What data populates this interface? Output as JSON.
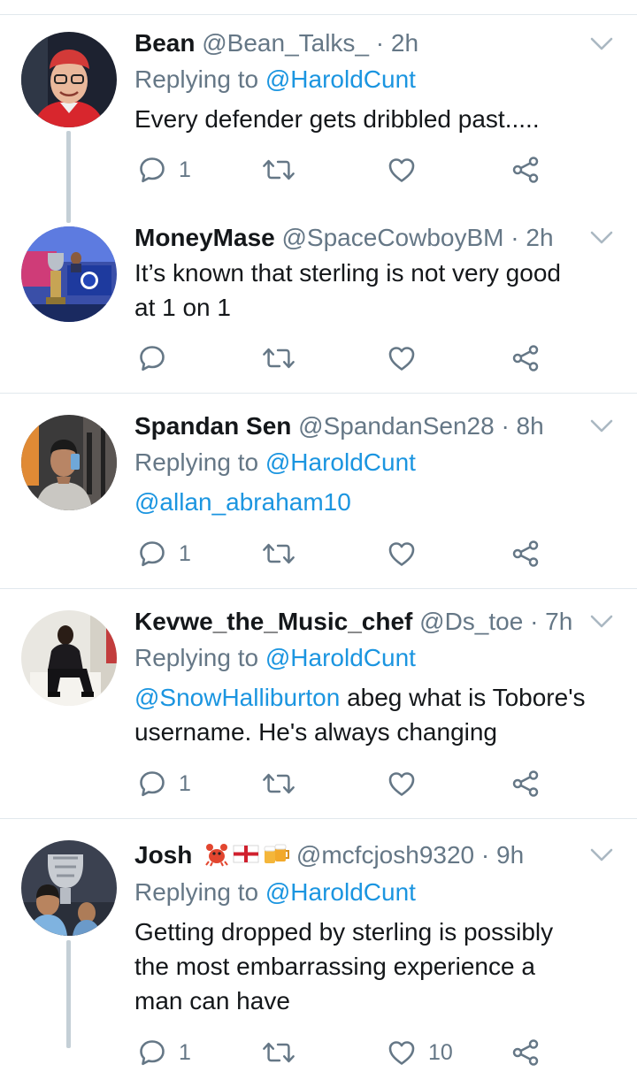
{
  "tweets": [
    {
      "name": "Bean",
      "handle": "@Bean_Talks_",
      "time": "2h",
      "replying_prefix": "Replying to ",
      "replying_to": "@HaroldCunt",
      "text": "Every defender gets dribbled past.....",
      "reply_count": "1",
      "retweet_count": "",
      "like_count": ""
    },
    {
      "name": "MoneyMase",
      "handle": "@SpaceCowboyBM",
      "time": "2h",
      "text_line1": "It’s known that sterling is not very good",
      "text_line2": "at 1 on 1",
      "reply_count": "",
      "retweet_count": "",
      "like_count": ""
    },
    {
      "name": "Spandan Sen",
      "handle": "@SpandanSen28",
      "time": "8h",
      "replying_prefix": "Replying to ",
      "replying_to": "@HaroldCunt",
      "mention": "@allan_abraham10",
      "reply_count": "1",
      "retweet_count": "",
      "like_count": ""
    },
    {
      "name": "Kevwe_the_Music_chef",
      "handle": "@Ds_toe",
      "time": "7h",
      "replying_prefix": "Replying to ",
      "replying_to": "@HaroldCunt",
      "mention": "@SnowHalliburton",
      "text_line1_rest": " abeg what is Tobore's",
      "text_line2": "username. He's always changing",
      "reply_count": "1",
      "retweet_count": "",
      "like_count": ""
    },
    {
      "name": "Josh",
      "handle": "@mcfcjosh9320",
      "time": "9h",
      "replying_prefix": "Replying to ",
      "replying_to": "@HaroldCunt",
      "text_line1": "Getting dropped by sterling is possibly",
      "text_line2": "the most embarrassing experience a",
      "text_line3": "man can have",
      "reply_count": "1",
      "retweet_count": "",
      "like_count": "10"
    }
  ],
  "separator": "·",
  "icons": {
    "reply": "reply-icon",
    "retweet": "retweet-icon",
    "like": "heart-icon",
    "share": "share-icon",
    "menu": "chevron-down-icon"
  },
  "colors": {
    "link": "#1b95e0",
    "secondary": "#657786",
    "text": "#14171a",
    "divider": "#e1e8ed"
  }
}
